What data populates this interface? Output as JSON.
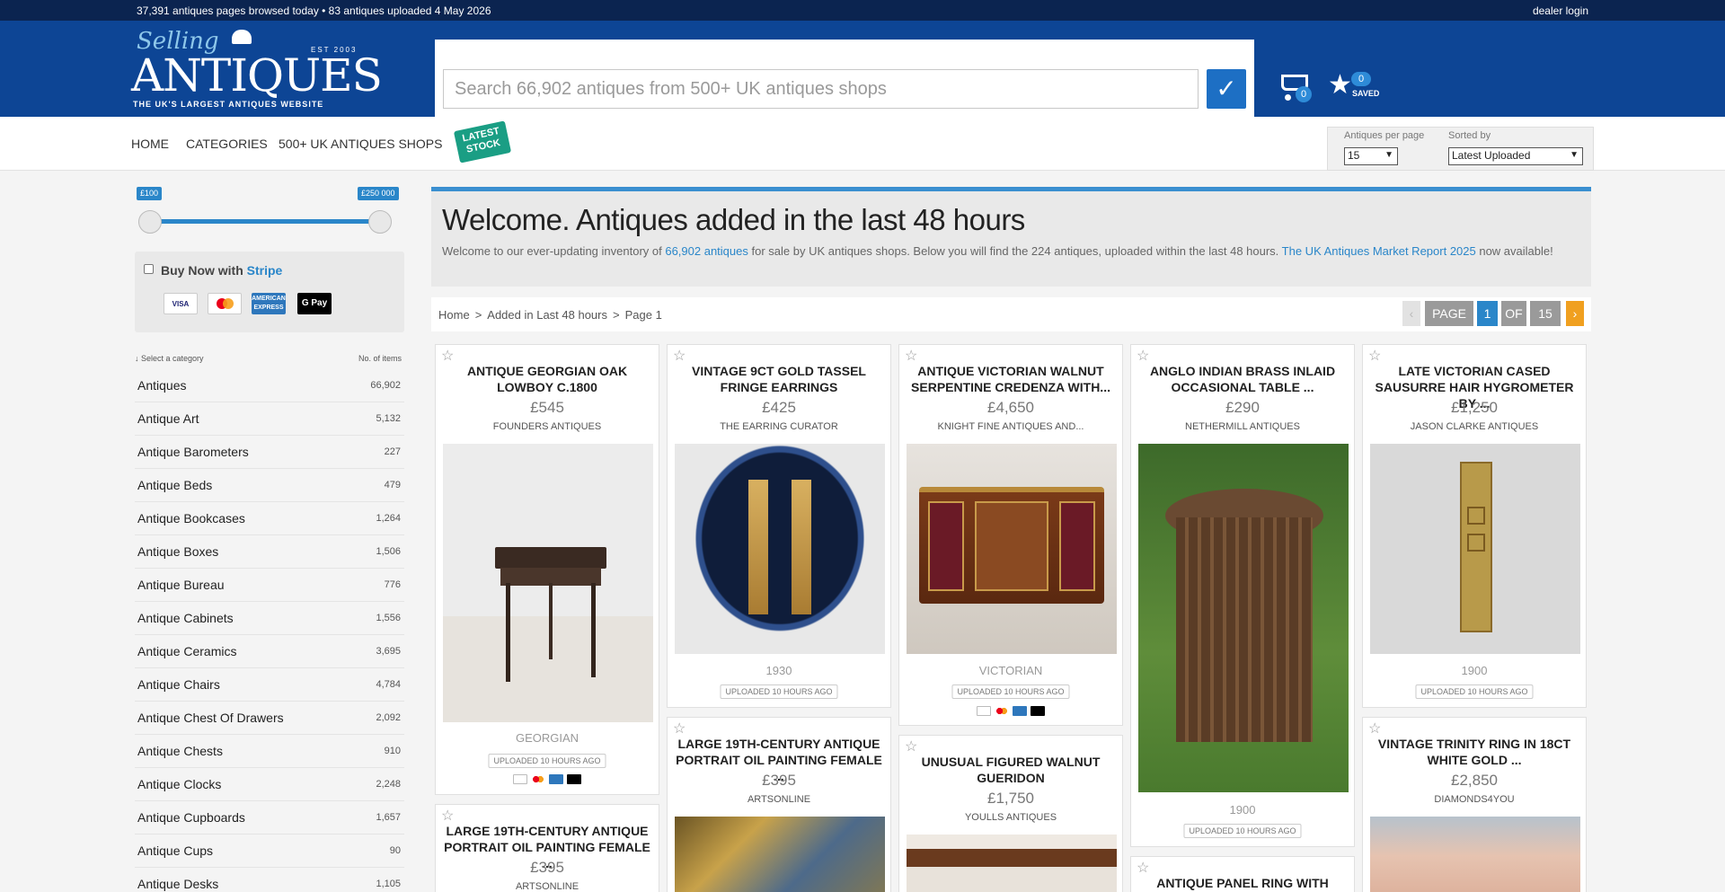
{
  "topbar": {
    "stats": "37,391 antiques pages browsed today • 83 antiques uploaded 4 May 2026",
    "dealer_login": "dealer login"
  },
  "logo": {
    "selling": "Selling",
    "antiques": "ANTIQUES",
    "est": "EST 2003",
    "tagline": "THE UK'S LARGEST ANTIQUES WEBSITE"
  },
  "search": {
    "placeholder": "Search 66,902 antiques from 500+ UK antiques shops",
    "submit_glyph": "✓"
  },
  "cart": {
    "count": "0"
  },
  "saved": {
    "count": "0",
    "label": "SAVED"
  },
  "nav": {
    "home": "HOME",
    "categories": "CATEGORIES",
    "shops": "500+ UK ANTIQUES SHOPS",
    "latest_line1": "LATEST",
    "latest_line2": "STOCK"
  },
  "controls": {
    "per_page_label": "Antiques per page",
    "per_page_value": "15",
    "sorted_label": "Sorted by",
    "sorted_value": "Latest Uploaded"
  },
  "price_filter": {
    "min": "£100",
    "max": "£250 000"
  },
  "buy_now": {
    "label": "Buy Now with",
    "stripe": "Stripe",
    "cards": [
      "VISA",
      "mastercard",
      "AMERICAN EXPRESS",
      "G Pay"
    ]
  },
  "categories_header": {
    "select": "↓ Select a category",
    "count": "No. of items"
  },
  "categories": [
    {
      "name": "Antiques",
      "count": "66,902"
    },
    {
      "name": "Antique Art",
      "count": "5,132"
    },
    {
      "name": "Antique Barometers",
      "count": "227"
    },
    {
      "name": "Antique Beds",
      "count": "479"
    },
    {
      "name": "Antique Bookcases",
      "count": "1,264"
    },
    {
      "name": "Antique Boxes",
      "count": "1,506"
    },
    {
      "name": "Antique Bureau",
      "count": "776"
    },
    {
      "name": "Antique Cabinets",
      "count": "1,556"
    },
    {
      "name": "Antique Ceramics",
      "count": "3,695"
    },
    {
      "name": "Antique Chairs",
      "count": "4,784"
    },
    {
      "name": "Antique Chest Of Drawers",
      "count": "2,092"
    },
    {
      "name": "Antique Chests",
      "count": "910"
    },
    {
      "name": "Antique Clocks",
      "count": "2,248"
    },
    {
      "name": "Antique Cupboards",
      "count": "1,657"
    },
    {
      "name": "Antique Cups",
      "count": "90"
    },
    {
      "name": "Antique Desks",
      "count": "1,105"
    }
  ],
  "welcome": {
    "title": "Welcome. Antiques added in the last 48 hours",
    "intro_1": "Welcome to our ever-updating inventory of ",
    "intro_link": "66,902 antiques",
    "intro_2": " for sale by UK antiques shops. Below you will find the 224 antiques, uploaded within the last 48 hours. ",
    "report_link": "The UK Antiques Market Report 2025",
    "intro_3": " now available!"
  },
  "breadcrumb": [
    "Home",
    "Added in Last 48 hours",
    "Page 1"
  ],
  "pager": {
    "prev": "‹",
    "page_label": "PAGE",
    "current": "1",
    "of": "OF",
    "total": "15",
    "next": "›"
  },
  "products": [
    {
      "title": "ANTIQUE GEORGIAN OAK LOWBOY C.1800",
      "price": "£545",
      "dealer": "FOUNDERS ANTIQUES",
      "period": "GEORGIAN",
      "uploaded": "UPLOADED 10 HOURS AGO"
    },
    {
      "title": "VINTAGE 9CT GOLD TASSEL FRINGE EARRINGS",
      "price": "£425",
      "dealer": "THE EARRING CURATOR",
      "period": "1930",
      "uploaded": "UPLOADED 10 HOURS AGO"
    },
    {
      "title": "ANTIQUE VICTORIAN WALNUT SERPENTINE CREDENZA WITH...",
      "price": "£4,650",
      "dealer": "KNIGHT FINE ANTIQUES AND...",
      "period": "VICTORIAN",
      "uploaded": "UPLOADED 10 HOURS AGO"
    },
    {
      "title": "ANGLO INDIAN BRASS INLAID OCCASIONAL TABLE ...",
      "price": "£290",
      "dealer": "NETHERMILL ANTIQUES",
      "period": "1900",
      "uploaded": "UPLOADED 10 HOURS AGO"
    },
    {
      "title": "LATE VICTORIAN CASED SAUSURRE HAIR HYGROMETER BY ...",
      "price": "£1,250",
      "dealer": "JASON CLARKE ANTIQUES",
      "period": "1900",
      "uploaded": "UPLOADED 10 HOURS AGO"
    },
    {
      "title": "LARGE 19TH-CENTURY ANTIQUE PORTRAIT OIL PAINTING FEMALE ...",
      "price": "£395",
      "dealer": "ARTSONLINE"
    },
    {
      "title": "LARGE 19TH-CENTURY ANTIQUE PORTRAIT OIL PAINTING FEMALE ...",
      "price": "£395",
      "dealer": "ARTSONLINE"
    },
    {
      "title": "UNUSUAL FIGURED WALNUT GUERIDON",
      "price": "£1,750",
      "dealer": "YOULLS ANTIQUES"
    },
    {
      "title": "ANTIQUE PANEL RING WITH"
    },
    {
      "title": "VINTAGE TRINITY RING IN 18CT WHITE GOLD ...",
      "price": "£2,850",
      "dealer": "DIAMONDS4YOU"
    }
  ]
}
